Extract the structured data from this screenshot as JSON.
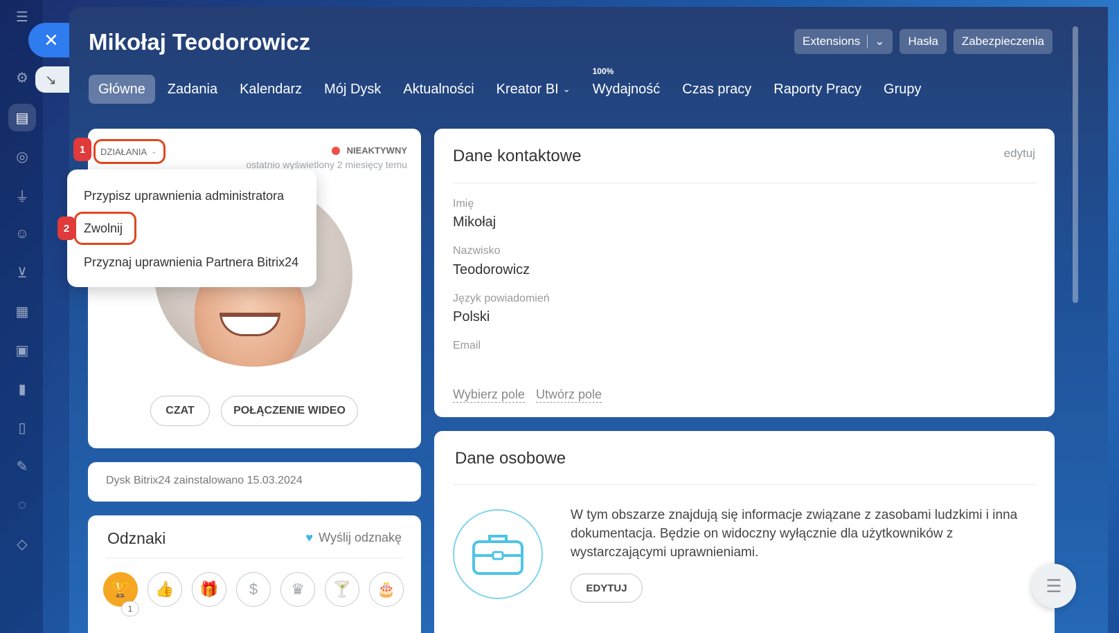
{
  "header": {
    "title": "Mikołaj Teodorowicz",
    "buttons": {
      "extensions": "Extensions",
      "passwords": "Hasła",
      "security": "Zabezpieczenia"
    }
  },
  "tabs": [
    {
      "label": "Główne",
      "active": true
    },
    {
      "label": "Zadania"
    },
    {
      "label": "Kalendarz"
    },
    {
      "label": "Mój Dysk"
    },
    {
      "label": "Aktualności"
    },
    {
      "label": "Kreator BI"
    },
    {
      "label": "Wydajność",
      "badge": "100%"
    },
    {
      "label": "Czas pracy"
    },
    {
      "label": "Raporty Pracy"
    },
    {
      "label": "Grupy"
    }
  ],
  "profile": {
    "actions_label": "DZIAŁANIA",
    "status": "NIEAKTYWNY",
    "last_seen": "ostatnio wyświetlony 2 miesięcy temu",
    "chat_button": "CZAT",
    "video_button": "POŁĄCZENIE WIDEO"
  },
  "callouts": {
    "one": "1",
    "two": "2"
  },
  "dropdown": {
    "items": [
      "Przypisz uprawnienia administratora",
      "Zwolnij",
      "Przyznaj uprawnienia Partnera Bitrix24"
    ]
  },
  "disk_info": "Dysk Bitrix24 zainstalowano 15.03.2024",
  "badges": {
    "title": "Odznaki",
    "send_label": "Wyślij odznakę",
    "first_count": "1"
  },
  "contact": {
    "title": "Dane kontaktowe",
    "edit": "edytuj",
    "fields": [
      {
        "label": "Imię",
        "value": "Mikołaj"
      },
      {
        "label": "Nazwisko",
        "value": "Teodorowicz"
      },
      {
        "label": "Język powiadomień",
        "value": "Polski"
      },
      {
        "label": "Email",
        "value": ""
      }
    ],
    "choose_field": "Wybierz pole",
    "create_field": "Utwórz pole"
  },
  "personal": {
    "title": "Dane osobowe",
    "text": "W tym obszarze znajdują się informacje związane z zasobami ludzkimi i inna dokumentacja. Będzie on widoczny wyłącznie dla użytkowników z wystarczającymi uprawnieniami.",
    "edit_button": "EDYTUJ"
  },
  "colors": {
    "accent": "#2f7bf0",
    "highlight": "#e0461f",
    "inactive": "#f0504a"
  }
}
